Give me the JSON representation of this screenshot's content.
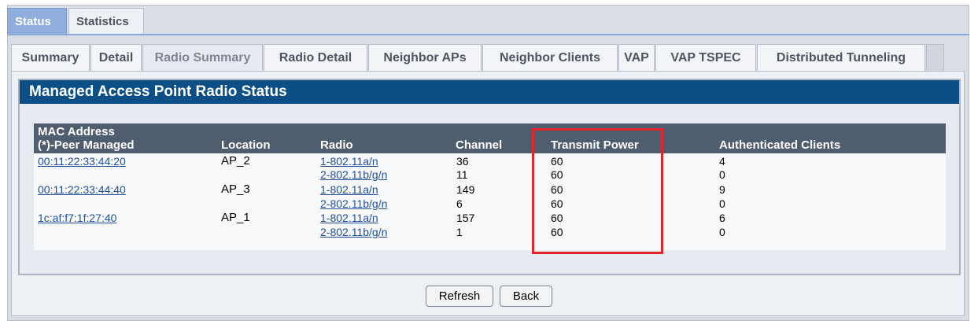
{
  "top_tabs": [
    {
      "label": "Status",
      "active": true
    },
    {
      "label": "Statistics",
      "active": false
    }
  ],
  "sub_tabs": [
    {
      "label": "Summary",
      "active": false
    },
    {
      "label": "Detail",
      "active": false
    },
    {
      "label": "Radio Summary",
      "active": true
    },
    {
      "label": "Radio Detail",
      "active": false
    },
    {
      "label": "Neighbor APs",
      "active": false
    },
    {
      "label": "Neighbor Clients",
      "active": false
    },
    {
      "label": "VAP",
      "active": false
    },
    {
      "label": "VAP TSPEC",
      "active": false
    },
    {
      "label": "Distributed Tunneling",
      "active": false
    }
  ],
  "panel": {
    "title": "Managed Access Point Radio Status"
  },
  "table": {
    "headers": {
      "mac_line1": "MAC Address",
      "mac_line2": "(*)-Peer Managed",
      "location": "Location",
      "radio": "Radio",
      "channel": "Channel",
      "transmit_power": "Transmit Power",
      "authenticated_clients": "Authenticated Clients"
    },
    "rows": [
      {
        "mac": "00:11:22:33:44:20",
        "location": "AP_2",
        "radio": "1-802.11a/n",
        "channel": "36",
        "power": "60",
        "clients": "4"
      },
      {
        "mac": "",
        "location": "",
        "radio": "2-802.11b/g/n",
        "channel": "11",
        "power": "60",
        "clients": "0"
      },
      {
        "mac": "00:11:22:33:44:40",
        "location": "AP_3",
        "radio": "1-802.11a/n",
        "channel": "149",
        "power": "60",
        "clients": "9"
      },
      {
        "mac": "",
        "location": "",
        "radio": "2-802.11b/g/n",
        "channel": "6",
        "power": "60",
        "clients": "0"
      },
      {
        "mac": "1c:af:f7:1f:27:40",
        "location": "AP_1",
        "radio": "1-802.11a/n",
        "channel": "157",
        "power": "60",
        "clients": "6"
      },
      {
        "mac": "",
        "location": "",
        "radio": "2-802.11b/g/n",
        "channel": "1",
        "power": "60",
        "clients": "0"
      }
    ]
  },
  "buttons": {
    "refresh": "Refresh",
    "back": "Back"
  },
  "colors": {
    "header_bar": "#0b4f86",
    "table_header": "#505d6f",
    "active_tab": "#8faede",
    "link": "#1f4f9b",
    "highlight": "#e2262a"
  }
}
